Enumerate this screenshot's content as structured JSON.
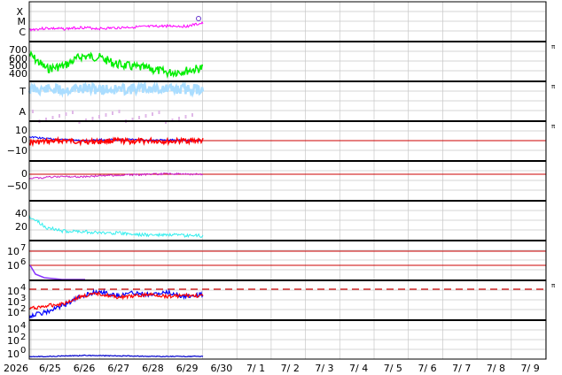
{
  "chart_data": {
    "type": "line",
    "x_ticks": [
      "2026",
      "6/25",
      "6/26",
      "6/27",
      "6/28",
      "6/29",
      "6/30",
      "7/ 1",
      "7/ 2",
      "7/ 3",
      "7/ 4",
      "7/ 5",
      "7/ 6",
      "7/ 7",
      "7/ 8",
      "7/ 9"
    ],
    "x_range": [
      "6/24",
      "7/10"
    ],
    "data_end": "6/29",
    "panels": [
      {
        "id": "xmc",
        "labels": [
          "X",
          "M",
          "C"
        ],
        "right_tag": "",
        "yticks": [],
        "series": [
          {
            "color": "#ff00ff",
            "values": [
              0.28,
              0.32,
              0.3,
              0.34,
              0.31,
              0.33,
              0.35,
              0.36,
              0.38,
              0.37,
              0.45
            ]
          }
        ]
      },
      {
        "id": "speed",
        "labels": [],
        "right_tag": "π",
        "yticks": [
          "700",
          "600",
          "500",
          "400"
        ],
        "ylim": [
          350,
          750
        ],
        "series": [
          {
            "color": "#00ee00",
            "values": [
              620,
              470,
              500,
              600,
              590,
              520,
              490,
              470,
              430,
              450,
              480
            ]
          }
        ]
      },
      {
        "id": "ta",
        "labels": [
          "T",
          "A"
        ],
        "right_tag": "π",
        "yticks": [],
        "series": [
          {
            "color": "#aaddff",
            "values": [
              0.8,
              0.8,
              0.78,
              0.82,
              0.8,
              0.79,
              0.81,
              0.82,
              0.8,
              0.8,
              0.8
            ]
          }
        ]
      },
      {
        "id": "bz",
        "labels": [],
        "right_tag": "π",
        "yticks": [
          "10",
          "0",
          "−10"
        ],
        "ylim": [
          -20,
          20
        ],
        "series": [
          {
            "color": "#ff0000",
            "values": [
              -2,
              -1,
              0,
              -1,
              -1,
              0,
              -1,
              0,
              -1,
              0,
              0
            ]
          },
          {
            "color": "#0000ff",
            "values": [
              4,
              2,
              1,
              0,
              1,
              1,
              1,
              0,
              1,
              0,
              0
            ]
          }
        ]
      },
      {
        "id": "dst",
        "labels": [],
        "right_tag": "",
        "yticks": [
          "0",
          "−50"
        ],
        "ylim": [
          -80,
          30
        ],
        "series": [
          {
            "color": "#cc22cc",
            "values": [
              -15,
              -12,
              -8,
              -10,
              -6,
              -4,
              -2,
              0,
              2,
              0,
              0
            ]
          }
        ]
      },
      {
        "id": "kp",
        "labels": [],
        "right_tag": "",
        "yticks": [
          "40",
          "20"
        ],
        "ylim": [
          0,
          50
        ],
        "series": [
          {
            "color": "#33eeee",
            "values": [
              30,
              15,
              10,
              10,
              8,
              8,
              6,
              5,
              5,
              4,
              4
            ]
          }
        ]
      },
      {
        "id": "proton",
        "labels": [],
        "right_tag": "",
        "yticks": [
          "10^7",
          "10^6"
        ],
        "series": [
          {
            "color": "#8833ff",
            "values": [
              0.9,
              0.35,
              0.15,
              0.05
            ]
          }
        ]
      },
      {
        "id": "electron",
        "labels": [],
        "right_tag": "π",
        "yticks": [
          "10^4",
          "10^3",
          "10^2"
        ],
        "series": [
          {
            "color": "#ff0000",
            "values": [
              1.2,
              1.5,
              1.8,
              2.6,
              2.9,
              2.5,
              2.6,
              2.8,
              2.6,
              2.7,
              2.6
            ]
          },
          {
            "color": "#0000ff",
            "values": [
              0.4,
              0.8,
              1.6,
              2.6,
              3.2,
              2.7,
              3.0,
              2.8,
              3.0,
              2.6,
              2.8
            ]
          }
        ]
      },
      {
        "id": "xray",
        "labels": [],
        "right_tag": "",
        "yticks": [
          "10^4",
          "10^2",
          "10^0"
        ],
        "series": [
          {
            "color": "#0000cc",
            "values": [
              0,
              0,
              0.05,
              0.1,
              0.1,
              0.05,
              0.05,
              0,
              0,
              0,
              0
            ]
          }
        ]
      }
    ]
  }
}
